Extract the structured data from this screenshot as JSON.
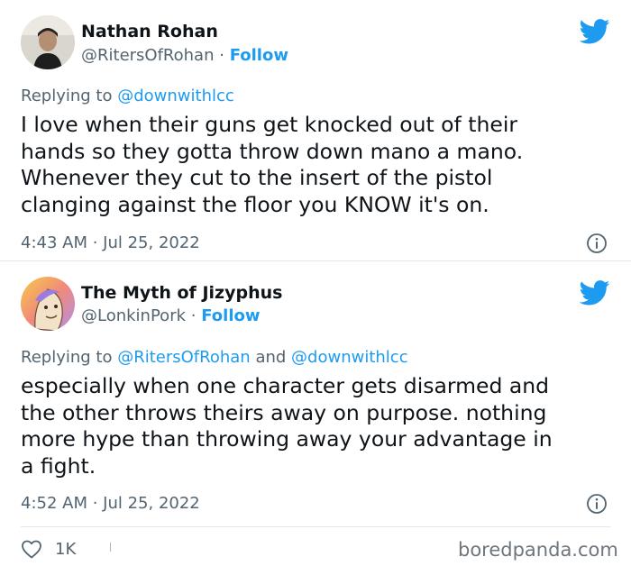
{
  "tweets": [
    {
      "author_name": "Nathan Rohan",
      "handle": "@RitersOfRohan",
      "separator": "·",
      "follow_label": "Follow",
      "replying_prefix": "Replying to",
      "replying_to": [
        "@downwithlcc"
      ],
      "text_lines": [
        "I love when their guns get knocked out of their",
        "hands so they gotta throw down mano a mano.",
        "Whenever they cut to the insert of the pistol",
        "clanging against the floor you KNOW it's on."
      ],
      "timestamp": "4:43 AM · Jul 25, 2022",
      "icons": {
        "platform": "twitter-bird-icon",
        "info": "info-icon"
      }
    },
    {
      "author_name": "The Myth of Jizyphus",
      "handle": "@LonkinPork",
      "separator": "·",
      "follow_label": "Follow",
      "replying_prefix": "Replying to",
      "replying_to": [
        "@RitersOfRohan",
        "@downwithlcc"
      ],
      "replying_joiner": "and",
      "text_lines": [
        "especially when one character gets disarmed and",
        "the other throws theirs away on purpose. nothing",
        "more hype than throwing away your advantage in",
        "a fight."
      ],
      "timestamp": "4:52 AM · Jul 25, 2022",
      "like_count": "1K",
      "icons": {
        "platform": "twitter-bird-icon",
        "info": "info-icon",
        "like": "heart-icon"
      }
    }
  ],
  "watermark": "boredpanda.com",
  "colors": {
    "accent": "#1d9bf0",
    "secondary_text": "#536471",
    "primary_text": "#0f1419",
    "divider": "#e1e8ed"
  }
}
